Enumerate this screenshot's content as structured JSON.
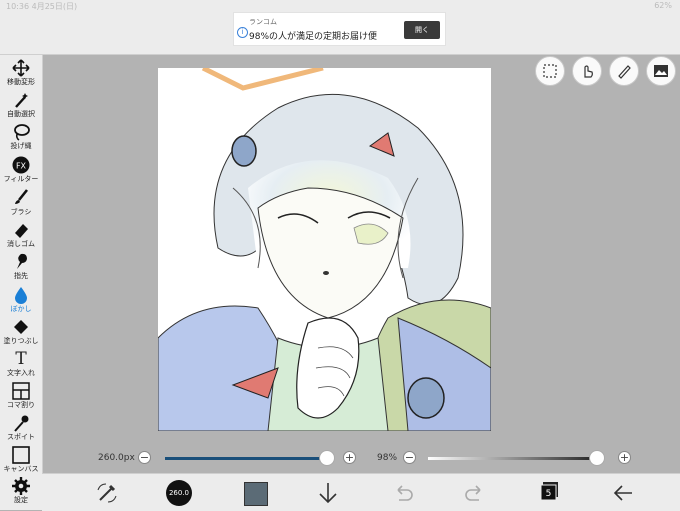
{
  "status_bar": {
    "time": "10:36",
    "date": "4月25日(日)",
    "battery": "62%"
  },
  "ad": {
    "sponsor": "ランコム",
    "headline": "98%の人が満足の定期お届け便",
    "open_label": "開く"
  },
  "tools": [
    {
      "label": "移動変形",
      "icon": "move-icon"
    },
    {
      "label": "自動選択",
      "icon": "magic-wand-icon"
    },
    {
      "label": "投げ縄",
      "icon": "lasso-icon"
    },
    {
      "label": "フィルター",
      "icon": "fx-icon",
      "glyph": "FX"
    },
    {
      "label": "ブラシ",
      "icon": "brush-icon"
    },
    {
      "label": "消しゴム",
      "icon": "eraser-icon"
    },
    {
      "label": "指先",
      "icon": "finger-icon"
    },
    {
      "label": "ぼかし",
      "icon": "blur-drop-icon",
      "active": true
    },
    {
      "label": "塗りつぶし",
      "icon": "fill-bucket-icon"
    },
    {
      "label": "文字入れ",
      "icon": "text-icon",
      "glyph": "T"
    },
    {
      "label": "コマ割り",
      "icon": "panel-icon"
    },
    {
      "label": "スポイト",
      "icon": "eyedropper-icon"
    },
    {
      "label": "キャンバス",
      "icon": "canvas-icon"
    },
    {
      "label": "設定",
      "icon": "gear-icon"
    }
  ],
  "sliders": {
    "size_label": "260.0px",
    "size_fraction": 1.0,
    "opacity_label": "98%",
    "opacity_fraction": 0.98
  },
  "bottom": {
    "brush_size_label": "260.0",
    "layer_count": "5",
    "color": "#5b6b76",
    "accent": "#1a4f7a"
  }
}
